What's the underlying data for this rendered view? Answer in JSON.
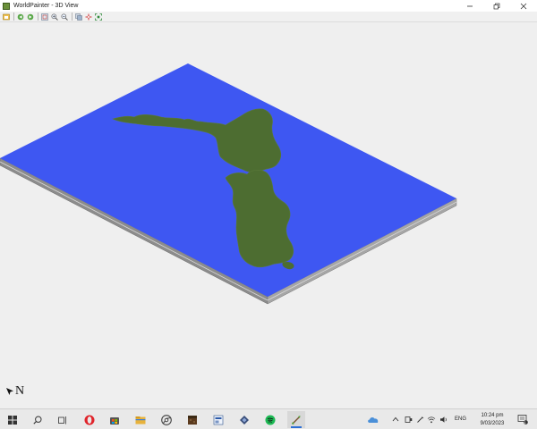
{
  "window": {
    "title": "WorldPainter - 3D View",
    "controls": [
      "minimize",
      "maximize",
      "close"
    ]
  },
  "toolbar": {
    "buttons": [
      {
        "icon": "save-image-icon"
      },
      {
        "icon": "rotate-left-icon"
      },
      {
        "icon": "rotate-right-icon"
      },
      {
        "icon": "reset-view-icon"
      },
      {
        "icon": "zoom-in-icon"
      },
      {
        "icon": "zoom-out-icon"
      },
      {
        "icon": "layers-icon"
      },
      {
        "icon": "move-to-spawn-icon"
      },
      {
        "icon": "fit-to-view-icon"
      }
    ]
  },
  "view": {
    "compass_label": "N",
    "water_color": "#3e57f2",
    "land_color": "#4d6d31",
    "base_color": "#8c8c8c"
  },
  "taskbar": {
    "apps": [
      {
        "icon": "windows-start-icon"
      },
      {
        "icon": "search-icon"
      },
      {
        "icon": "task-view-icon"
      },
      {
        "icon": "opera-icon"
      },
      {
        "icon": "store-icon"
      },
      {
        "icon": "file-explorer-icon"
      },
      {
        "icon": "chromium-icon"
      },
      {
        "icon": "minecraft-icon"
      },
      {
        "icon": "app-icon"
      },
      {
        "icon": "network-app-icon"
      },
      {
        "icon": "spotify-icon"
      },
      {
        "icon": "worldpainter-icon"
      }
    ],
    "tray": {
      "language": "ENG",
      "time": "10:24 pm",
      "date": "9/03/2023",
      "notification_count": "1"
    }
  }
}
